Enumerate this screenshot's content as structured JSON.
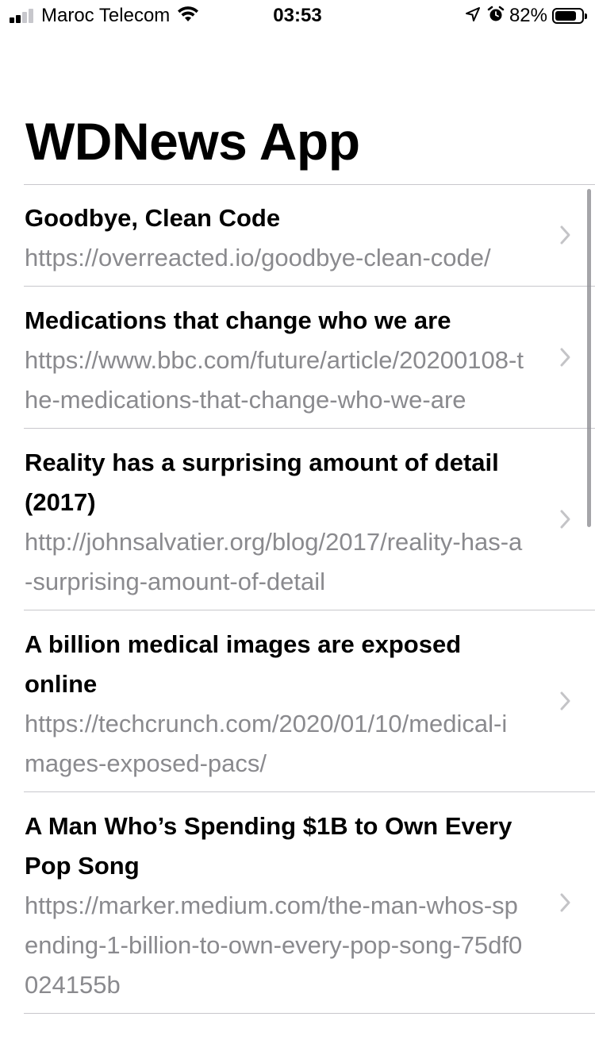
{
  "status_bar": {
    "carrier": "Maroc Telecom",
    "time": "03:53",
    "battery_percent": "82%",
    "battery_level": 0.82,
    "signal_bars_active": 2,
    "signal_bars_total": 4,
    "icons": [
      "signal-icon",
      "wifi-icon",
      "location-arrow-icon",
      "alarm-icon",
      "battery-icon"
    ]
  },
  "page": {
    "title": "WDNews App"
  },
  "articles": [
    {
      "title": "Goodbye, Clean Code",
      "url": "https://overreacted.io/goodbye-clean-code/"
    },
    {
      "title": "Medications that change who we are",
      "url": "https://www.bbc.com/future/article/20200108-the-medications-that-change-who-we-are"
    },
    {
      "title": "Reality has a surprising amount of detail (2017)",
      "url": "http://johnsalvatier.org/blog/2017/reality-has-a-surprising-amount-of-detail"
    },
    {
      "title": "A billion medical images are exposed online",
      "url": "https://techcrunch.com/2020/01/10/medical-images-exposed-pacs/"
    },
    {
      "title": "A Man Who’s Spending $1B to Own Every Pop Song",
      "url": "https://marker.medium.com/the-man-whos-spending-1-billion-to-own-every-pop-song-75df0024155b"
    }
  ],
  "colors": {
    "url_text": "#8a8a8e",
    "divider": "#c8c7cc",
    "chevron": "#c4c4c7"
  }
}
